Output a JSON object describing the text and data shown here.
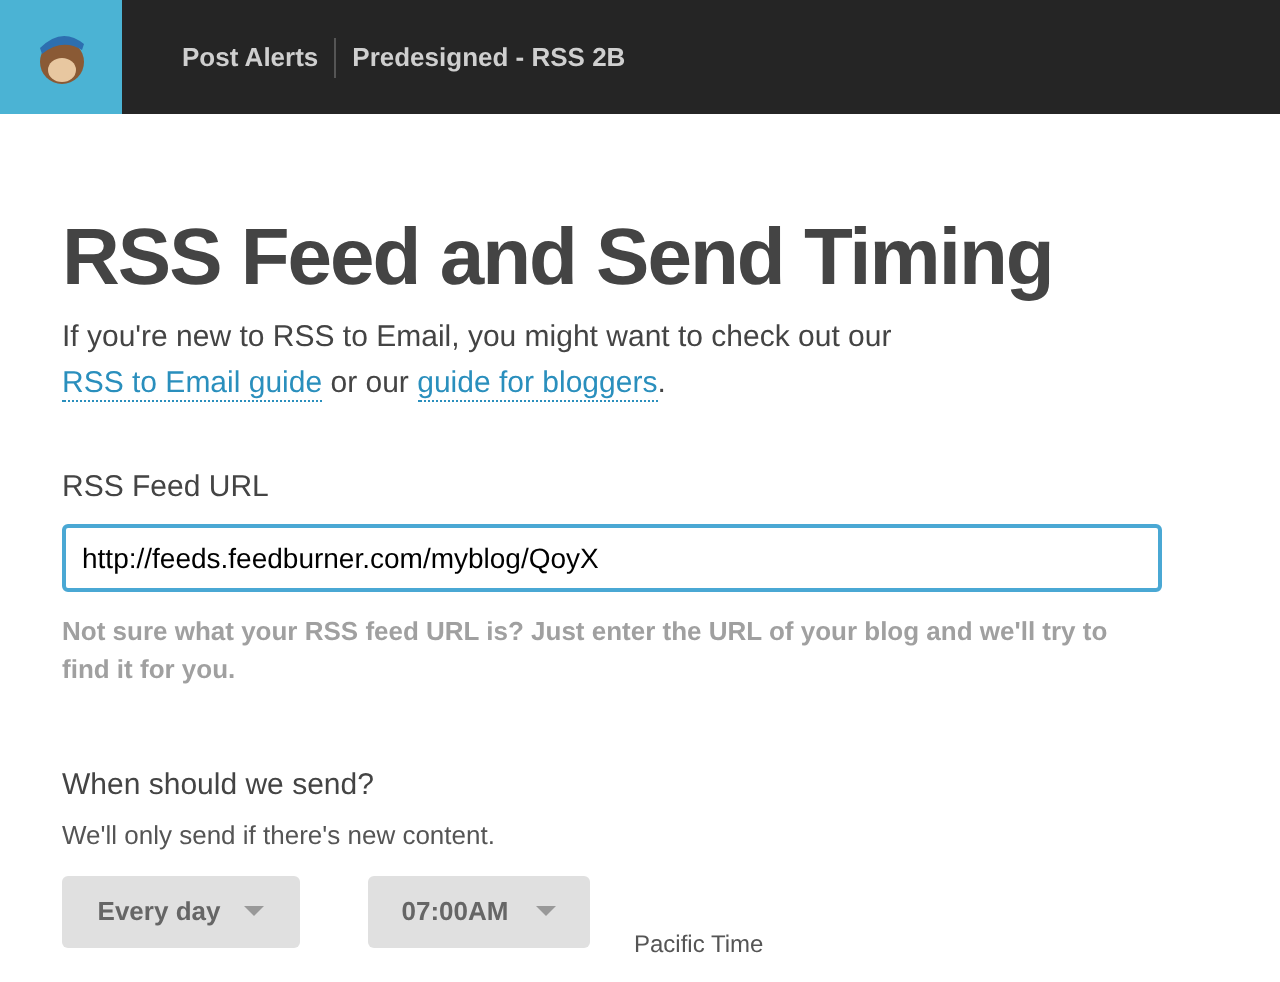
{
  "header": {
    "breadcrumbs": [
      {
        "label": "Post Alerts"
      },
      {
        "label": "Predesigned - RSS 2B"
      }
    ]
  },
  "title": "RSS Feed and Send Timing",
  "intro": [
    {
      "kind": "text",
      "text": "If you're new to RSS to Email, you might want to check out our "
    },
    {
      "kind": "link",
      "text": "RSS to Email guide"
    },
    {
      "kind": "text",
      "text": " or our "
    },
    {
      "kind": "link",
      "text": "guide for bloggers"
    },
    {
      "kind": "text",
      "text": "."
    }
  ],
  "feed_url": {
    "label": "RSS Feed URL",
    "value": "http://feeds.feedburner.com/myblog/QoyX",
    "focused": true,
    "help": "Not sure what your RSS feed URL is? Just enter the URL of your blog and we'll try to find it for you."
  },
  "schedule": {
    "heading": "When should we send?",
    "note": "We'll only send if there's new content.",
    "frequency": "Every day",
    "time": "07:00AM",
    "timezone": "Pacific Time"
  }
}
